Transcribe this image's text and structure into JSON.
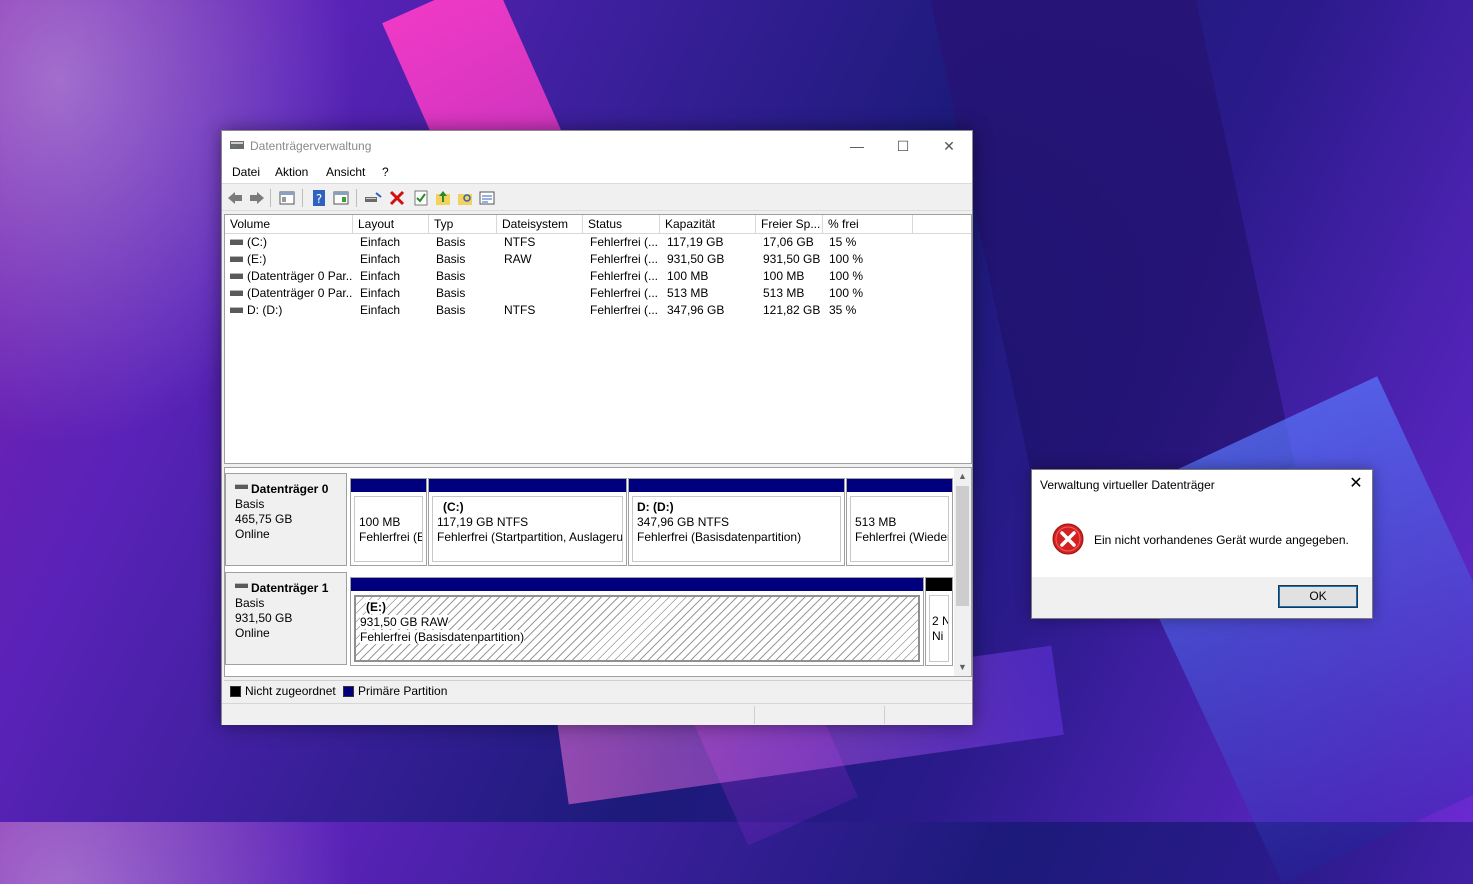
{
  "window": {
    "title": "Datenträgerverwaltung",
    "minimize": "—",
    "maximize": "☐",
    "close": "✕"
  },
  "menu": [
    "Datei",
    "Aktion",
    "Ansicht",
    "?"
  ],
  "columns": [
    "Volume",
    "Layout",
    "Typ",
    "Dateisystem",
    "Status",
    "Kapazität",
    "Freier Sp...",
    "% frei"
  ],
  "volumes": [
    {
      "volume": "(C:)",
      "layout": "Einfach",
      "typ": "Basis",
      "fs": "NTFS",
      "status": "Fehlerfrei (...",
      "cap": "117,19 GB",
      "free": "17,06 GB",
      "pct": "15 %"
    },
    {
      "volume": "(E:)",
      "layout": "Einfach",
      "typ": "Basis",
      "fs": "RAW",
      "status": "Fehlerfrei (...",
      "cap": "931,50 GB",
      "free": "931,50 GB",
      "pct": "100 %"
    },
    {
      "volume": "(Datenträger 0 Par...",
      "layout": "Einfach",
      "typ": "Basis",
      "fs": "",
      "status": "Fehlerfrei (...",
      "cap": "100 MB",
      "free": "100 MB",
      "pct": "100 %"
    },
    {
      "volume": "(Datenträger 0 Par...",
      "layout": "Einfach",
      "typ": "Basis",
      "fs": "",
      "status": "Fehlerfrei (...",
      "cap": "513 MB",
      "free": "513 MB",
      "pct": "100 %"
    },
    {
      "volume": "D: (D:)",
      "layout": "Einfach",
      "typ": "Basis",
      "fs": "NTFS",
      "status": "Fehlerfrei (...",
      "cap": "347,96 GB",
      "free": "121,82 GB",
      "pct": "35 %"
    }
  ],
  "disks": [
    {
      "name": "Datenträger 0",
      "type": "Basis",
      "size": "465,75 GB",
      "state": "Online",
      "partitions": [
        {
          "title": "",
          "line1": "100 MB",
          "line2": "Fehlerfrei (E"
        },
        {
          "title": "(C:)",
          "line1": "117,19 GB NTFS",
          "line2": "Fehlerfrei (Startpartition, Auslageru"
        },
        {
          "title": "D:  (D:)",
          "line1": "347,96 GB NTFS",
          "line2": "Fehlerfrei (Basisdatenpartition)"
        },
        {
          "title": "",
          "line1": "513 MB",
          "line2": "Fehlerfrei (Wieder"
        }
      ]
    },
    {
      "name": "Datenträger 1",
      "type": "Basis",
      "size": "931,50 GB",
      "state": "Online",
      "partitions": [
        {
          "title": "(E:)",
          "line1": "931,50 GB RAW",
          "line2": "Fehlerfrei (Basisdatenpartition)"
        },
        {
          "title": "",
          "line1": "2 N",
          "line2": "Ni"
        }
      ]
    }
  ],
  "legend": [
    {
      "label": "Nicht zugeordnet",
      "color": "#000000"
    },
    {
      "label": "Primäre Partition",
      "color": "#00007f"
    }
  ],
  "dialog": {
    "title": "Verwaltung virtueller Datenträger",
    "close": "✕",
    "message": "Ein nicht vorhandenes Gerät wurde angegeben.",
    "ok": "OK"
  },
  "colors": {
    "primary_partition": "#00007f",
    "unallocated": "#000000",
    "error_red": "#d32020"
  }
}
